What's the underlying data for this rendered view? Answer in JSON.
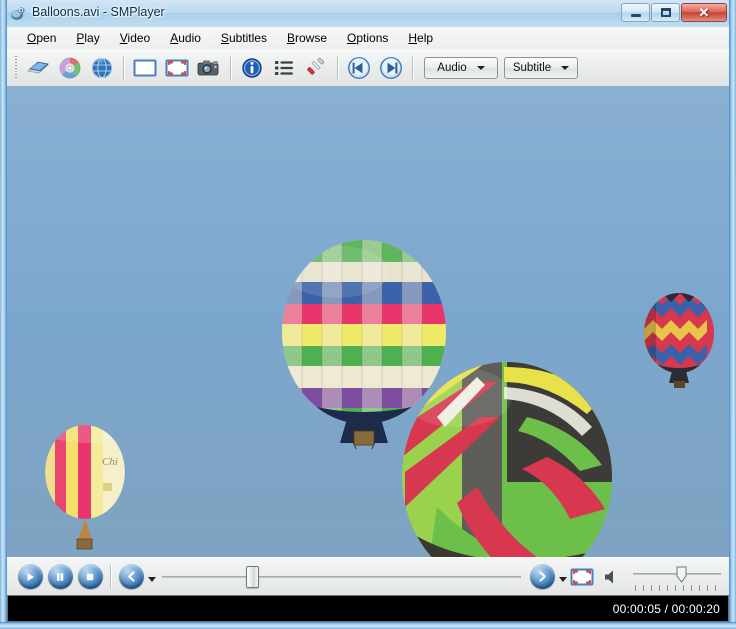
{
  "window": {
    "title": "Balloons.avi - SMPlayer",
    "app_icon": "smplayer-icon",
    "minimize_label": "Minimize",
    "maximize_label": "Maximize",
    "close_label": "Close",
    "close_glyph": "✕"
  },
  "menubar": {
    "items": [
      {
        "label": "Open",
        "mnemonic": "O",
        "name": "menu-open"
      },
      {
        "label": "Play",
        "mnemonic": "P",
        "name": "menu-play"
      },
      {
        "label": "Video",
        "mnemonic": "V",
        "name": "menu-video"
      },
      {
        "label": "Audio",
        "mnemonic": "A",
        "name": "menu-audio"
      },
      {
        "label": "Subtitles",
        "mnemonic": "S",
        "name": "menu-subtitles"
      },
      {
        "label": "Browse",
        "mnemonic": "B",
        "name": "menu-browse"
      },
      {
        "label": "Options",
        "mnemonic": "O",
        "name": "menu-options"
      },
      {
        "label": "Help",
        "mnemonic": "H",
        "name": "menu-help"
      }
    ]
  },
  "toolbar": {
    "buttons": [
      {
        "name": "open-file-button",
        "icon": "blue-book-icon",
        "tooltip": "Open file"
      },
      {
        "name": "open-dvd-button",
        "icon": "dvd-disc-icon",
        "tooltip": "Open DVD"
      },
      {
        "name": "open-url-button",
        "icon": "globe-icon",
        "tooltip": "Open URL"
      },
      {
        "name": "compact-mode-button",
        "icon": "window-icon",
        "tooltip": "Compact mode"
      },
      {
        "name": "fullscreen-button",
        "icon": "fullscreen-icon",
        "tooltip": "Fullscreen"
      },
      {
        "name": "screenshot-button",
        "icon": "camera-icon",
        "tooltip": "Screenshot"
      },
      {
        "name": "info-button",
        "icon": "info-icon",
        "tooltip": "Media information"
      },
      {
        "name": "playlist-button",
        "icon": "playlist-icon",
        "tooltip": "Playlist"
      },
      {
        "name": "preferences-button",
        "icon": "screwdriver-icon",
        "tooltip": "Preferences"
      },
      {
        "name": "previous-button",
        "icon": "skip-previous-icon",
        "tooltip": "Previous"
      },
      {
        "name": "next-button",
        "icon": "skip-next-icon",
        "tooltip": "Next"
      }
    ],
    "audio_dropdown": "Audio",
    "subtitle_dropdown": "Subtitle"
  },
  "video": {
    "scene": "four hot air balloons in blue sky",
    "sky_color": "#7ba5cb",
    "balloons": [
      {
        "name": "balloon-left-striped",
        "pattern": "vertical stripes",
        "colors": [
          "#f2e06a",
          "#e8456f",
          "#f6efc8",
          "#e87a3c"
        ]
      },
      {
        "name": "balloon-checkered",
        "pattern": "checkerboard",
        "colors": [
          "#4fb050",
          "#f3f0e2",
          "#e8356c",
          "#3b61a8",
          "#7e4ca0",
          "#1d2a4a"
        ]
      },
      {
        "name": "balloon-large-chevron",
        "pattern": "chevron panels",
        "colors": [
          "#6cc04a",
          "#e8e14a",
          "#d8384f",
          "#3d3b38",
          "#f0f0e8"
        ]
      },
      {
        "name": "balloon-right-zigzag",
        "pattern": "zigzag",
        "colors": [
          "#d8384f",
          "#3b61a8",
          "#e8c54a",
          "#2b2b33"
        ]
      }
    ]
  },
  "controls": {
    "play_label": "Play",
    "pause_label": "Pause",
    "stop_label": "Stop",
    "rewind_label": "Rewind",
    "forward_label": "Forward",
    "fullscreen_label": "Fullscreen",
    "mute_label": "Mute",
    "seek_position_percent": 25,
    "volume_percent": 55,
    "volume_tick_count": 11
  },
  "statusbar": {
    "time": "00:00:05 / 00:00:20",
    "current_time": "00:00:05",
    "total_time": "00:00:20"
  }
}
